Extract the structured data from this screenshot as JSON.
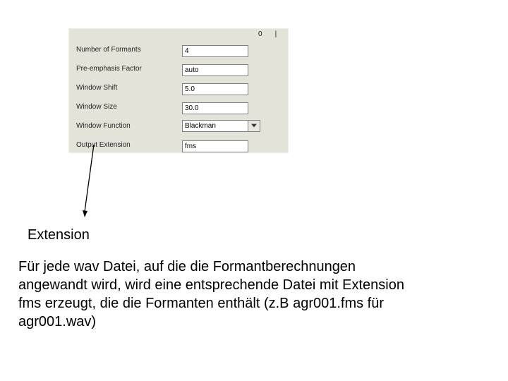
{
  "ticks": {
    "mid": "0",
    "right": "|"
  },
  "fields": {
    "num_formants": {
      "label": "Number of Formants",
      "value": "4"
    },
    "preemph": {
      "label": "Pre-emphasis Factor",
      "value": "auto"
    },
    "win_shift": {
      "label": "Window Shift",
      "value": "5.0"
    },
    "win_size": {
      "label": "Window Size",
      "value": "30.0"
    },
    "win_func": {
      "label": "Window Function",
      "value": "Blackman"
    },
    "out_ext": {
      "label": "Output Extension",
      "value": "fms"
    }
  },
  "caption": "Extension",
  "paragraph": "Für jede wav Datei, auf die die Formantberechnungen angewandt wird, wird eine entsprechende Datei mit Extension fms erzeugt, die die Formanten enthält (z.B agr001.fms für agr001.wav)"
}
